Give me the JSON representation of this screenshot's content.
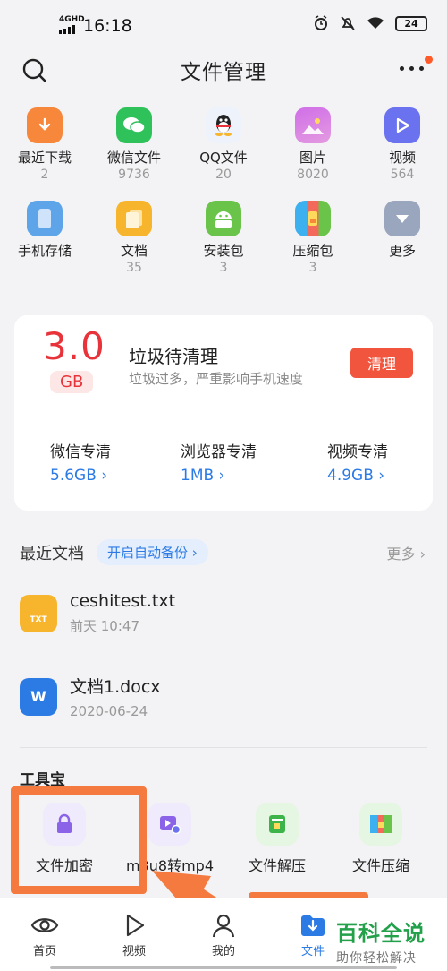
{
  "status": {
    "network": "4GHD",
    "time": "16:18",
    "battery": "24"
  },
  "header": {
    "title": "文件管理"
  },
  "categories": [
    {
      "label": "最近下载",
      "count": "2",
      "color": "#f7873a"
    },
    {
      "label": "微信文件",
      "count": "9736",
      "color": "#2fc25b"
    },
    {
      "label": "QQ文件",
      "count": "20",
      "color": "#eef3fb"
    },
    {
      "label": "图片",
      "count": "8020",
      "color": "#c86be0"
    },
    {
      "label": "视频",
      "count": "564",
      "color": "#6a72f0"
    },
    {
      "label": "手机存储",
      "count": "",
      "color": "#5da4e8"
    },
    {
      "label": "文档",
      "count": "35",
      "color": "#f6b52c"
    },
    {
      "label": "安装包",
      "count": "3",
      "color": "#6ac44a"
    },
    {
      "label": "压缩包",
      "count": "3",
      "color": "#3db0f0"
    },
    {
      "label": "更多",
      "count": "",
      "color": "#9aa6bd"
    }
  ],
  "clean": {
    "size": "3.0",
    "unit": "GB",
    "title": "垃圾待清理",
    "subtitle": "垃圾过多，严重影响手机速度",
    "button": "清理",
    "items": [
      {
        "label": "微信专清",
        "value": "5.6GB"
      },
      {
        "label": "浏览器专清",
        "value": "1MB"
      },
      {
        "label": "视频专清",
        "value": "4.9GB"
      }
    ]
  },
  "recent": {
    "title": "最近文档",
    "backup": "开启自动备份",
    "more": "更多",
    "files": [
      {
        "name": "ceshitest.txt",
        "meta": "前天 10:47",
        "icon_text": "TXT"
      },
      {
        "name": "文档1.docx",
        "meta": "2020-06-24",
        "icon_text": "W"
      }
    ]
  },
  "tools": {
    "title": "工具宝",
    "items": [
      {
        "label": "文件加密"
      },
      {
        "label": "m3u8转mp4"
      },
      {
        "label": "文件解压"
      },
      {
        "label": "文件压缩"
      }
    ]
  },
  "nav": [
    {
      "label": "首页"
    },
    {
      "label": "视频"
    },
    {
      "label": "我的"
    },
    {
      "label": "文件"
    }
  ],
  "watermark": {
    "line1": "百科全说",
    "line2": "助你轻松解决"
  },
  "colors": {
    "accent": "#2c7be5",
    "danger": "#e8333a",
    "highlight": "#f57a40"
  }
}
